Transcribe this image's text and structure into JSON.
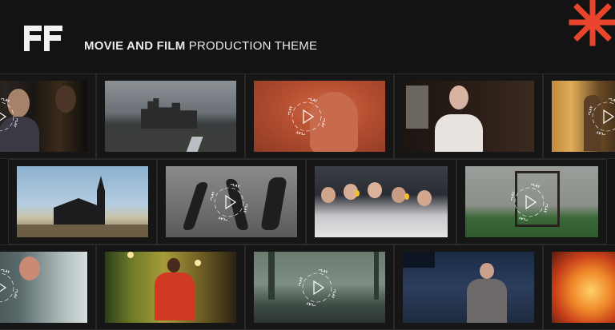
{
  "header": {
    "title_bold": "MOVIE AND FILM",
    "title_light": "PRODUCTION THEME"
  },
  "play_label": "PLAY",
  "colors": {
    "background": "#131313",
    "accent": "#e8452c",
    "grid_line": "#2a2a2a",
    "text": "#e9e9e9"
  },
  "icons": [
    "ff-logo-icon",
    "asterisk-icon",
    "play-icon"
  ],
  "rows": [
    {
      "cells": [
        {
          "name": "woman-portrait-thumb",
          "play": true
        },
        {
          "name": "castle-ruins-thumb",
          "play": false
        },
        {
          "name": "red-figure-thumb",
          "play": true
        },
        {
          "name": "woman-white-dress-thumb",
          "play": false
        },
        {
          "name": "doorway-figure-thumb",
          "play": true
        }
      ]
    },
    {
      "cells": [
        {
          "name": "black-church-thumb",
          "play": false
        },
        {
          "name": "running-figures-thumb",
          "play": true
        },
        {
          "name": "choir-boys-thumb",
          "play": false
        },
        {
          "name": "field-frame-thumb",
          "play": true
        }
      ]
    },
    {
      "cells": [
        {
          "name": "bath-woman-thumb",
          "play": true
        },
        {
          "name": "hallway-woman-thumb",
          "play": false
        },
        {
          "name": "misty-lake-thumb",
          "play": true
        },
        {
          "name": "church-man-thumb",
          "play": false
        },
        {
          "name": "fire-thumb",
          "play": false
        }
      ]
    }
  ]
}
